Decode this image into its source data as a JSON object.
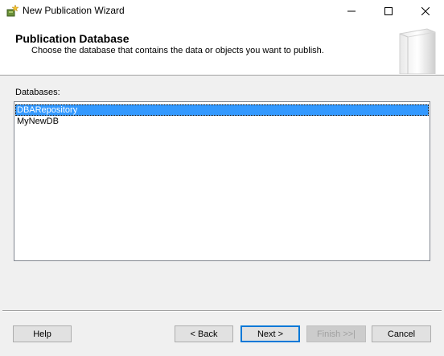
{
  "window": {
    "title": "New Publication Wizard",
    "icon": "wizard-star-icon"
  },
  "header": {
    "title": "Publication Database",
    "subtitle": "Choose the database that contains the data or objects you want to publish."
  },
  "databases": {
    "label": "Databases:",
    "items": [
      {
        "name": "DBARepository",
        "selected": true
      },
      {
        "name": "MyNewDB",
        "selected": false
      }
    ]
  },
  "buttons": {
    "help": "Help",
    "back": "< Back",
    "next": "Next >",
    "finish": "Finish >>|",
    "cancel": "Cancel"
  },
  "colors": {
    "selection": "#3399ff",
    "focus_border": "#0078d7"
  }
}
